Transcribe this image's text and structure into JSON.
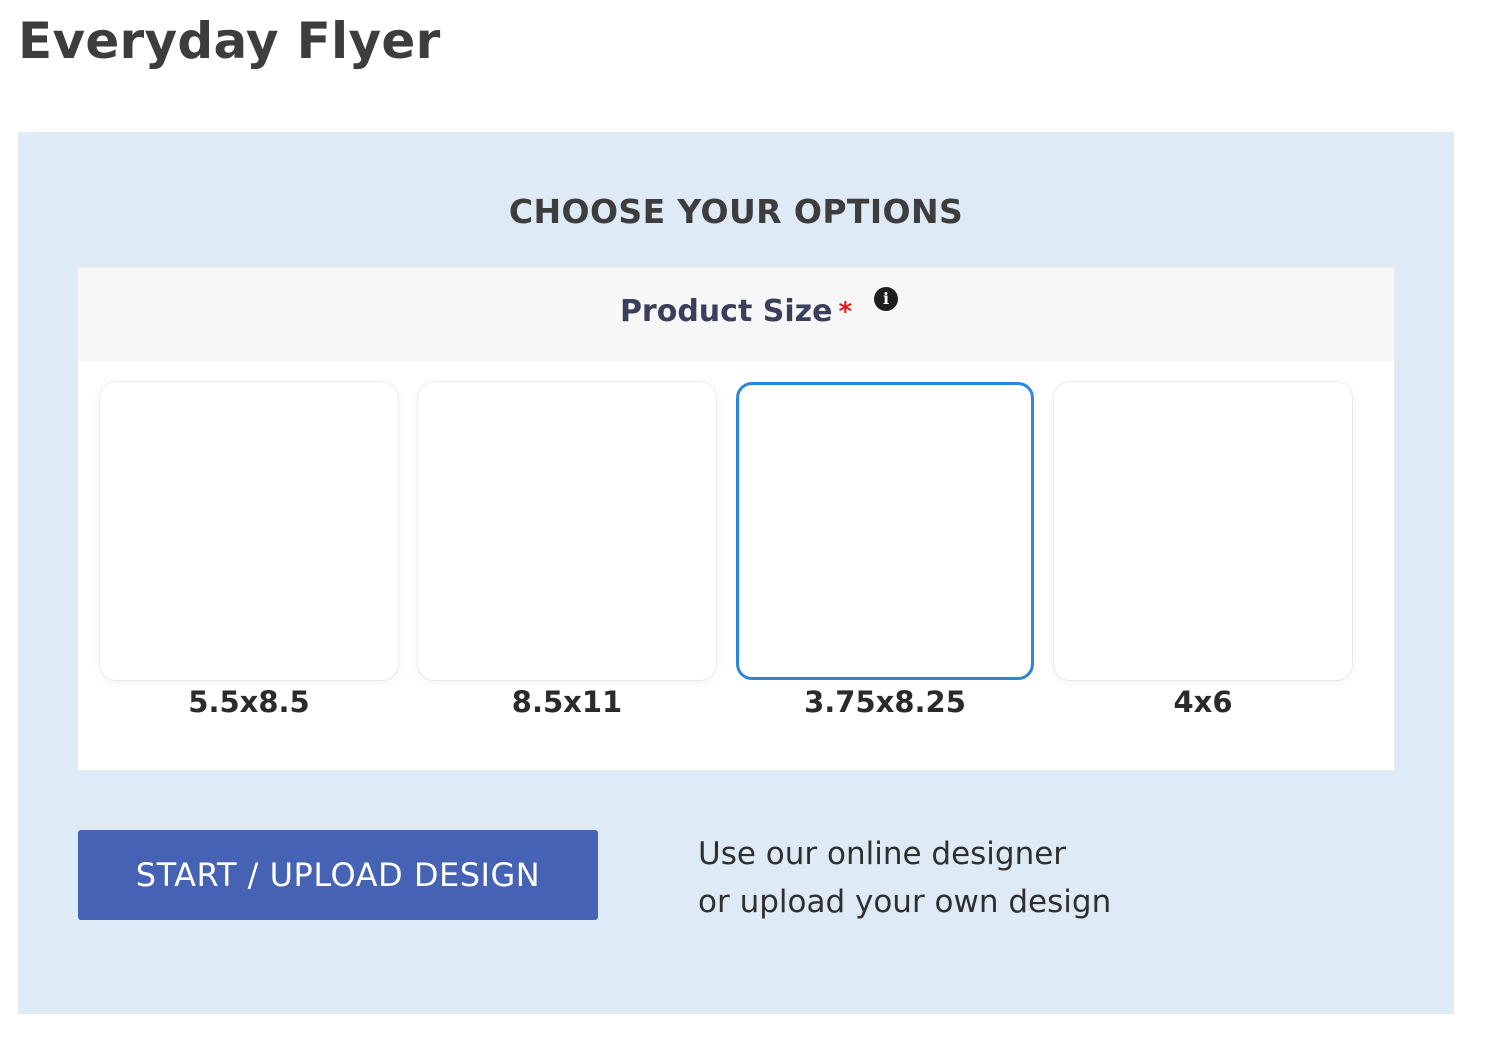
{
  "page": {
    "title": "Everyday Flyer"
  },
  "options": {
    "heading": "CHOOSE YOUR OPTIONS",
    "product_size": {
      "label": "Product Size",
      "required_marker": "*",
      "info_icon": "info-icon",
      "info_glyph": "i",
      "selected": "3.75x8.25",
      "sizes": [
        {
          "label": "5.5x8.5",
          "selected": false
        },
        {
          "label": "8.5x11",
          "selected": false
        },
        {
          "label": "3.75x8.25",
          "selected": true
        },
        {
          "label": "4x6",
          "selected": false
        }
      ]
    }
  },
  "actions": {
    "start_button_label": "START / UPLOAD DESIGN",
    "hint_line_1": "Use our online designer",
    "hint_line_2": "or upload your own design"
  },
  "colors": {
    "panel_background": "#deebf6",
    "button": "#4562b5",
    "selected_border": "#2d86d9",
    "required": "#e01b1b"
  }
}
